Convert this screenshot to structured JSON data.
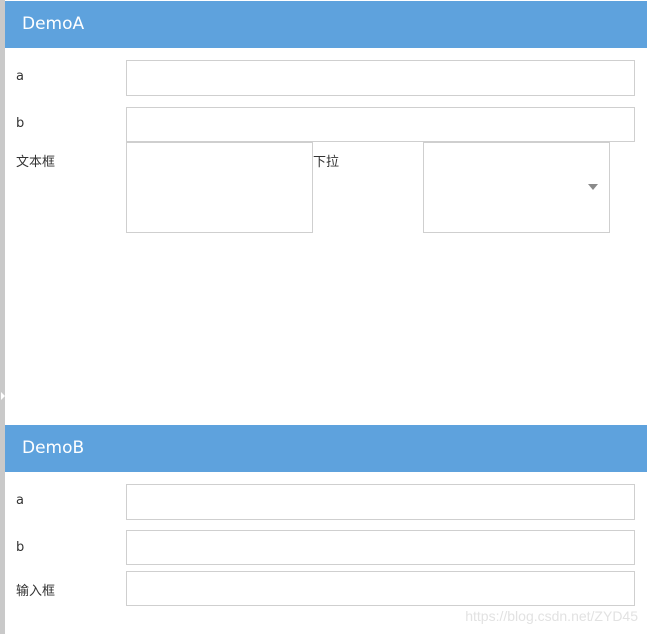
{
  "panels": [
    {
      "title": "DemoA",
      "fields": [
        {
          "label": "a",
          "value": ""
        },
        {
          "label": "b",
          "value": ""
        },
        {
          "label": "文本框",
          "value": ""
        }
      ],
      "dropdown": {
        "label": "下拉",
        "value": "",
        "icon": "caret-down-icon"
      }
    },
    {
      "title": "DemoB",
      "fields": [
        {
          "label": "a",
          "value": ""
        },
        {
          "label": "b",
          "value": ""
        },
        {
          "label": "输入框",
          "value": ""
        }
      ]
    }
  ],
  "watermark": "https://blog.csdn.net/ZYD45",
  "colors": {
    "header": "#5ea2dd",
    "field_border": "#cfcfcf",
    "left_strip": "#c9c9c9"
  }
}
